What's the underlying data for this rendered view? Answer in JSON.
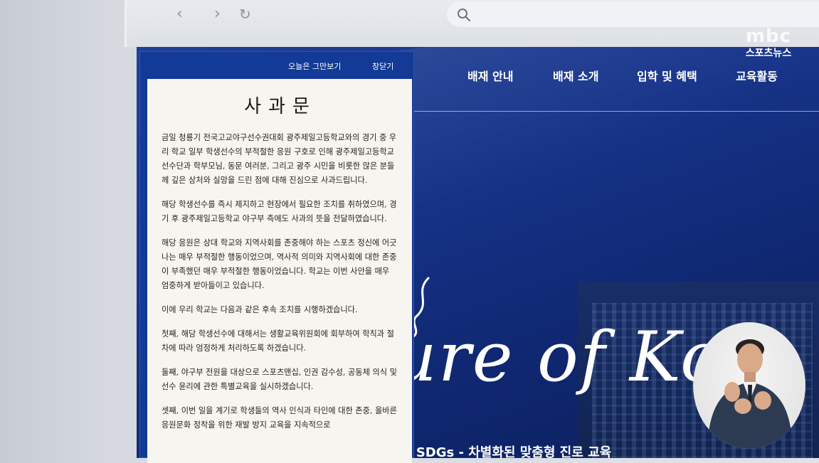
{
  "browser": {
    "back_icon": "chevron-left-icon",
    "forward_icon": "chevron-right-icon",
    "reload_icon": "reload-icon",
    "search_icon": "search-icon",
    "address_value": "",
    "back_glyph": "‹",
    "forward_glyph": "›",
    "reload_glyph": "↻"
  },
  "site": {
    "nav": [
      "배재 안내",
      "배재 소개",
      "입학 및 혜택",
      "교육활동"
    ],
    "script_text": "ure of Kor",
    "slogan": "재 SDGs - 차별화된 맞춤형 진로 교육"
  },
  "popup": {
    "hide_today": "오늘은 그만보기",
    "close": "창닫기",
    "title": "사과문",
    "paragraphs": [
      "금일 청룡기 전국고교야구선수권대회 광주제일고등학교와의 경기 중 우리 학교 일부 학생선수의 부적절한 응원 구호로 인해 광주제일고등학교 선수단과 학부모님, 동문 여러분, 그리고 광주 시민을 비롯한 많은 분들께 깊은 상처와 실망을 드린 점에 대해 진심으로 사과드립니다.",
      "해당 학생선수를 즉시 제지하고 현장에서 필요한 조치를 취하였으며, 경기 후 광주제일고등학교 야구부 측에도 사과의 뜻을 전달하였습니다.",
      "해당 응원은 상대 학교와 지역사회를 존중해야 하는 스포츠 정신에 어긋나는 매우 부적절한 행동이었으며, 역사적 의미와 지역사회에 대한 존중이 부족했던 매우 부적절한 행동이었습니다. 학교는 이번 사안을 매우 엄중하게 받아들이고 있습니다.",
      "이에 우리 학교는 다음과 같은 후속 조치를 시행하겠습니다.",
      "첫째, 해당 학생선수에 대해서는 생활교육위원회에 회부하여 학칙과 절차에 따라 엄정하게 처리하도록 하겠습니다.",
      "둘째, 야구부 전원을 대상으로 스포츠맨십, 인권 감수성, 공동체 의식 및 선수 윤리에 관한 특별교육을 실시하겠습니다.",
      "셋째, 이번 일을 계기로 학생들의 역사 인식과 타인에 대한 존중, 올바른 응원문화 정착을 위한 재발 방지 교육을 지속적으로"
    ]
  },
  "broadcaster": {
    "logo": "mbc",
    "name": "스포츠뉴스"
  },
  "colors": {
    "site_blue": "#17348a",
    "popup_blue": "#123a96",
    "doc_paper": "#f7f5ef"
  }
}
